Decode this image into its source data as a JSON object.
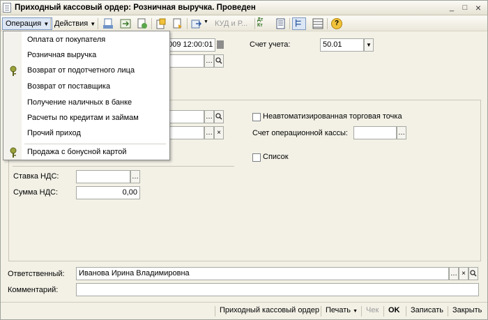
{
  "window": {
    "title": "Приходный кассовый ордер: Розничная выручка. Проведен",
    "minimize": "_",
    "maximize": "□",
    "close": "×"
  },
  "toolbar": {
    "operation": "Операция",
    "actions": "Действия",
    "kudir": "КУД и Р...",
    "dt_kt": "Дт\nКт",
    "help": "?"
  },
  "form": {
    "date_value": "2009 12:00:01",
    "account_label": "Счет учета:",
    "account_value": "50.01",
    "unautomated_label": "Неавтоматизированная торговая точка",
    "cash_account_label": "Счет операционной кассы:",
    "cash_account_value": "",
    "list_label": "Список",
    "vat_rate_label": "Ставка НДС:",
    "vat_rate_value": "",
    "vat_sum_label": "Сумма НДС:",
    "vat_sum_value": "0,00",
    "responsible_label": "Ответственный:",
    "responsible_value": "Иванова Ирина Владимировна",
    "comment_label": "Комментарий:",
    "comment_value": ""
  },
  "menu": {
    "items": [
      {
        "label": "Оплата от покупателя",
        "icon": ""
      },
      {
        "label": "Розничная выручка",
        "icon": ""
      },
      {
        "label": "Возврат от подотчетного лица",
        "icon": "key-icon"
      },
      {
        "label": "Возврат от поставщика",
        "icon": ""
      },
      {
        "label": "Получение наличных в банке",
        "icon": ""
      },
      {
        "label": "Расчеты по кредитам и займам",
        "icon": ""
      },
      {
        "label": "Прочий приход",
        "icon": ""
      },
      {
        "label": "Продажа с бонусной картой",
        "icon": "key-icon"
      }
    ]
  },
  "bottom": {
    "print_form": "Приходный кассовый ордер",
    "print": "Печать",
    "check": "Чек",
    "ok": "OK",
    "save": "Записать",
    "close": "Закрыть"
  },
  "colors": {
    "accent": "#7d98c2",
    "key_icon": "#9aa23a"
  }
}
